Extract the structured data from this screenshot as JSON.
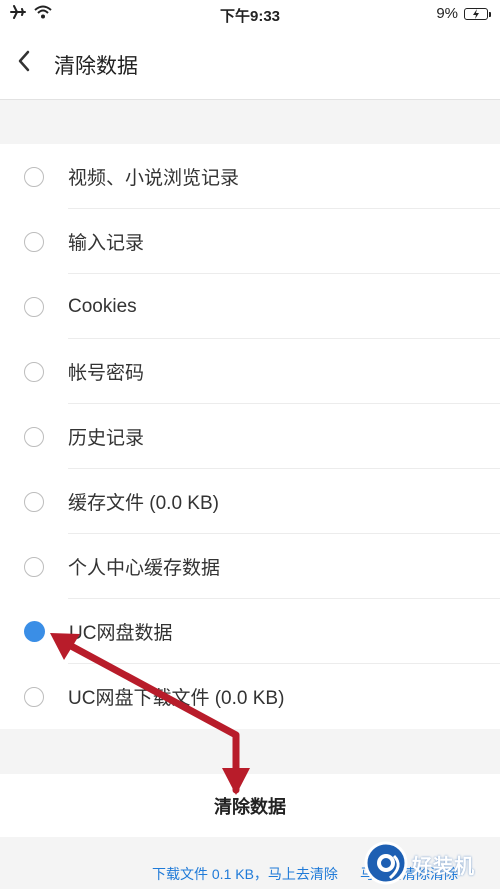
{
  "status_bar": {
    "time": "下午9:33",
    "battery": "9%"
  },
  "header": {
    "title": "清除数据"
  },
  "options": [
    {
      "label": "视频、小说浏览记录",
      "checked": false
    },
    {
      "label": "输入记录",
      "checked": false
    },
    {
      "label": "Cookies",
      "checked": false
    },
    {
      "label": "帐号密码",
      "checked": false
    },
    {
      "label": "历史记录",
      "checked": false
    },
    {
      "label": "缓存文件 (0.0 KB)",
      "checked": false
    },
    {
      "label": "个人中心缓存数据",
      "checked": false
    },
    {
      "label": "UC网盘数据",
      "checked": true
    },
    {
      "label": "UC网盘下载文件 (0.0 KB)",
      "checked": false
    }
  ],
  "clear_button": {
    "label": "清除数据"
  },
  "bottom_tip": {
    "text1": "下载文件 0.1 KB，马上去清除",
    "text2": "马上去清除清除"
  },
  "watermark": {
    "text": "好装机"
  },
  "colors": {
    "accent": "#3a8ee6",
    "annotation_arrow": "#b81c2a",
    "link": "#1f7ad8"
  }
}
